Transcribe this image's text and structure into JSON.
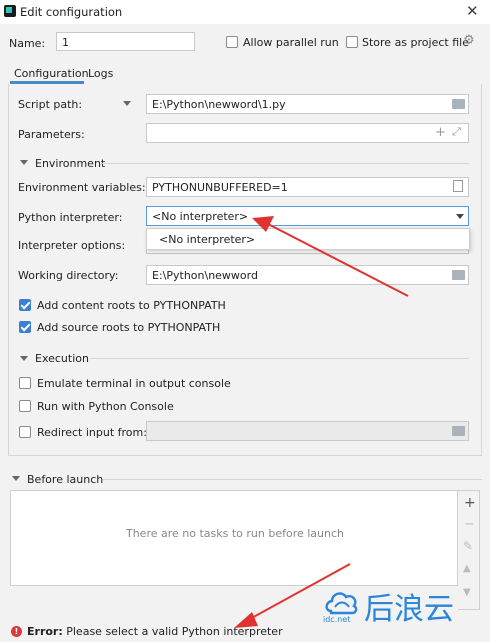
{
  "window": {
    "title": "Edit configuration",
    "close_glyph": "✕",
    "app_icon": "pycharm-icon"
  },
  "header": {
    "name_label": "Name:",
    "name_value": "1",
    "allow_parallel_label": "Allow parallel run",
    "allow_parallel_checked": false,
    "store_project_label": "Store as project file",
    "store_project_checked": false
  },
  "tabs": [
    {
      "label": "Configuration",
      "active": true
    },
    {
      "label": "Logs",
      "active": false
    }
  ],
  "form": {
    "script_path_label": "Script path:",
    "script_path_value": "E:\\Python\\newword\\1.py",
    "parameters_label": "Parameters:",
    "parameters_value": "",
    "environment_section": "Environment",
    "env_vars_label": "Environment variables:",
    "env_vars_value": "PYTHONUNBUFFERED=1",
    "interpreter_label": "Python interpreter:",
    "interpreter_value": "<No interpreter>",
    "interpreter_options": [
      "<No interpreter>"
    ],
    "interpreter_options_label": "Interpreter options:",
    "working_dir_label": "Working directory:",
    "working_dir_value": "E:\\Python\\newword",
    "add_content_roots_label": "Add content roots to PYTHONPATH",
    "add_content_roots_checked": true,
    "add_source_roots_label": "Add source roots to PYTHONPATH",
    "add_source_roots_checked": true,
    "execution_section": "Execution",
    "emulate_terminal_label": "Emulate terminal in output console",
    "emulate_terminal_checked": false,
    "python_console_label": "Run with Python Console",
    "python_console_checked": false,
    "redirect_input_label": "Redirect input from:",
    "redirect_input_checked": false,
    "redirect_input_value": ""
  },
  "before_launch": {
    "label": "Before launch",
    "empty_text": "There are no tasks to run before launch",
    "tools": [
      "+",
      "−",
      "✎",
      "▲",
      "▼"
    ]
  },
  "status": {
    "error_prefix": "Error:",
    "error_message": " Please select a valid Python interpreter"
  },
  "watermark": {
    "brand": "后浪云",
    "domain": "idc.net"
  },
  "colors": {
    "accent": "#3d7ed6",
    "arrow": "#e0322f",
    "error": "#d93a3a",
    "watermark": "#2a86d9"
  }
}
